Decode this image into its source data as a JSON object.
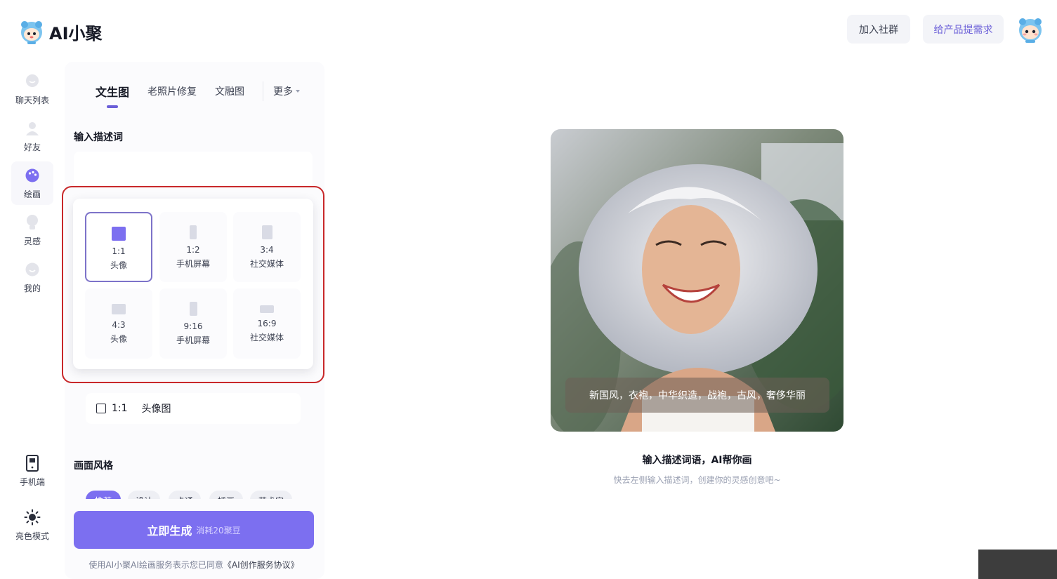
{
  "header": {
    "logo_text": "AI小聚",
    "btn_community": "加入社群",
    "btn_feedback": "给产品提需求"
  },
  "rail": {
    "items": [
      {
        "label": "聊天列表",
        "icon": "chat-bubble-icon"
      },
      {
        "label": "好友",
        "icon": "person-icon"
      },
      {
        "label": "绘画",
        "icon": "palette-icon",
        "active": true
      },
      {
        "label": "灵感",
        "icon": "lightbulb-icon"
      },
      {
        "label": "我的",
        "icon": "smile-icon"
      }
    ],
    "bottom": [
      {
        "label": "手机端",
        "icon": "phone-icon"
      },
      {
        "label": "亮色模式",
        "icon": "sun-icon"
      }
    ]
  },
  "tabs": {
    "items": [
      "文生图",
      "老照片修复",
      "文融图"
    ],
    "active": "文生图",
    "more": "更多"
  },
  "prompt_section": {
    "title": "输入描述词"
  },
  "ratios": [
    {
      "value": "1:1",
      "label": "头像",
      "selected": true
    },
    {
      "value": "1:2",
      "label": "手机屏幕"
    },
    {
      "value": "3:4",
      "label": "社交媒体"
    },
    {
      "value": "4:3",
      "label": "头像"
    },
    {
      "value": "9:16",
      "label": "手机屏幕"
    },
    {
      "value": "16:9",
      "label": "社交媒体"
    }
  ],
  "size_row": {
    "ratio": "1:1",
    "label": "头像图"
  },
  "style_section": {
    "title": "画面风格",
    "chips": [
      "推荐",
      "设计",
      "卡通",
      "插画",
      "艺术家"
    ]
  },
  "generate": {
    "label": "立即生成",
    "cost": "消耗20聚豆"
  },
  "agreement": {
    "prefix": "使用AI小聚AI绘画服务表示您已同意",
    "link": "《AI创作服务协议》"
  },
  "preview": {
    "prompt": "新国风，衣袍，中华织造，战袍，古风，奢侈华丽",
    "hint_title": "输入描述词语，AI帮你画",
    "hint_sub": "快去左侧输入描述词，创建你的灵感创意吧~"
  },
  "colors": {
    "accent": "#7c6ff0",
    "highlight": "#c8282a"
  }
}
